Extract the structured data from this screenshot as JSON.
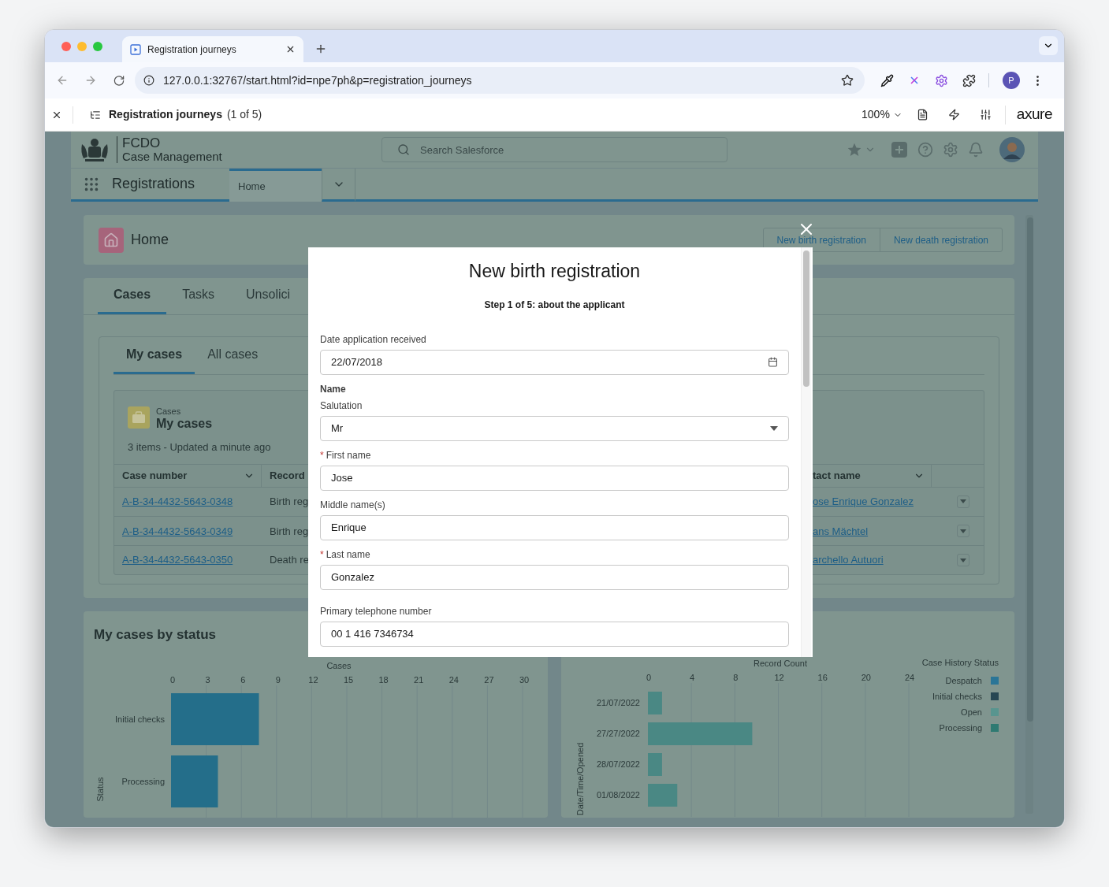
{
  "browser": {
    "tab": {
      "title": "Registration journeys"
    },
    "url": "127.0.0.1:32767/start.html?id=npe7ph&p=registration_journeys",
    "profile_initial": "P"
  },
  "prototype_bar": {
    "page_title": "Registration journeys",
    "page_count": "(1 of 5)",
    "zoom": "100%",
    "logo": "axure"
  },
  "app": {
    "org_name": "FCDO",
    "org_subtitle": "Case Management",
    "search": {
      "placeholder": "Search Salesforce"
    },
    "app_name": "Registrations",
    "nav_tabs": [
      {
        "label": "Home",
        "selected": true
      }
    ]
  },
  "home": {
    "title": "Home",
    "actions": [
      "New birth registration",
      "New death registration"
    ]
  },
  "cases_panel": {
    "tabs": [
      {
        "label": "Cases",
        "selected": true
      },
      {
        "label": "Tasks",
        "selected": false
      },
      {
        "label": "Unsolici",
        "selected": false
      }
    ],
    "subtabs": [
      {
        "label": "My cases",
        "selected": true
      },
      {
        "label": "All cases",
        "selected": false
      }
    ],
    "list": {
      "object": "Cases",
      "title": "My cases",
      "meta": "3 items - Updated a minute ago",
      "columns": [
        "Case number",
        "Record",
        "tact name"
      ],
      "rows": [
        {
          "case_number": "A-B-34-4432-5643-0348",
          "record_type": "Birth reg",
          "contact": "ose Enrique Gonzalez"
        },
        {
          "case_number": "A-B-34-4432-5643-0349",
          "record_type": "Birth reg",
          "contact": "ans Mächtel"
        },
        {
          "case_number": "A-B-34-4432-5643-0350",
          "record_type": "Death re",
          "contact": "archello Autuori"
        }
      ]
    }
  },
  "charts": [
    {
      "title": "My cases by status",
      "chart_data": {
        "type": "bar",
        "orientation": "horizontal",
        "xlabel": "Cases",
        "ylabel": "Status",
        "categories": [
          "Initial checks",
          "Processing"
        ],
        "values": [
          7.5,
          4
        ],
        "grid": true,
        "xlim": [
          0,
          30
        ],
        "xticks": [
          0,
          3,
          6,
          9,
          12,
          15,
          18,
          21,
          24,
          27,
          30
        ]
      }
    },
    {
      "legend_title": "Case History Status",
      "legend": [
        {
          "label": "Despatch",
          "color": "#2a7597"
        },
        {
          "label": "Initial checks",
          "color": "#264653"
        },
        {
          "label": "Open",
          "color": "#58958f"
        },
        {
          "label": "Processing",
          "color": "#2f7a72"
        }
      ],
      "chart_data": {
        "type": "bar",
        "orientation": "horizontal",
        "xlabel": "Record Count",
        "ylabel": "Date/Time/Opened",
        "categories": [
          "21/07/2022",
          "27/27/2022",
          "28/07/2022",
          "01/08/2022"
        ],
        "values": [
          1.3,
          9.6,
          1.3,
          2.7
        ],
        "grid": true,
        "xlim": [
          0,
          24
        ],
        "xticks": [
          0,
          4,
          8,
          12,
          16,
          20,
          24
        ]
      }
    }
  ],
  "modal": {
    "title": "New birth registration",
    "step": "Step 1 of 5: about the applicant",
    "fields": [
      {
        "kind": "date",
        "label": "Date application received",
        "value": "22/07/2018"
      },
      {
        "kind": "heading",
        "label": "Name"
      },
      {
        "kind": "select",
        "label": "Salutation",
        "value": "Mr"
      },
      {
        "kind": "text",
        "label": "First name",
        "required_mark": "*",
        "value": "Jose"
      },
      {
        "kind": "text",
        "label": "Middle name(s)",
        "value": "Enrique"
      },
      {
        "kind": "text",
        "label": "Last name",
        "required_mark": "*",
        "value": "Gonzalez"
      },
      {
        "kind": "text",
        "label": "Primary telephone number",
        "value": "00 1 416 7346734"
      }
    ]
  }
}
